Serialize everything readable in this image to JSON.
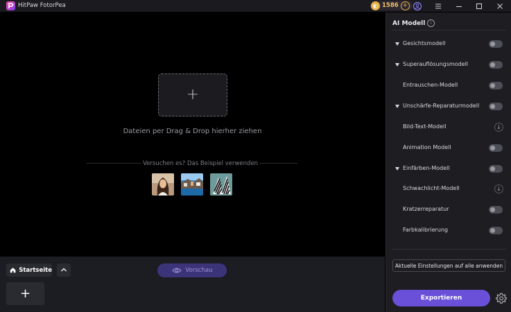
{
  "window": {
    "title": "HitPaw FotorPea",
    "coins": "1586"
  },
  "canvas": {
    "drop_text": "Dateien per Drag & Drop hierher ziehen",
    "try_text": "Versuchen es? Das Beispiel verwenden",
    "samples": [
      "portrait-sample",
      "coast-sample",
      "zebra-sample"
    ]
  },
  "bottom": {
    "home_label": "Startseite",
    "preview_label": "Vorschau"
  },
  "panel": {
    "title": "AI Modell",
    "models": [
      {
        "label": "Gesichtsmodell",
        "caret": true,
        "control": "toggle",
        "on": false
      },
      {
        "label": "Superauflösungsmodell",
        "caret": true,
        "control": "toggle",
        "on": false
      },
      {
        "label": "Entrauschen-Modell",
        "caret": false,
        "control": "toggle",
        "on": false
      },
      {
        "label": "Unschärfe-Reparaturmodell",
        "caret": true,
        "control": "toggle",
        "on": false
      },
      {
        "label": "Bild-Text-Modell",
        "caret": false,
        "control": "download",
        "on": false
      },
      {
        "label": "Animation Modell",
        "caret": false,
        "control": "toggle",
        "on": false
      },
      {
        "label": "Einfärben-Modell",
        "caret": true,
        "control": "toggle",
        "on": false
      },
      {
        "label": "Schwachlicht-Modell",
        "caret": false,
        "control": "download",
        "on": false
      },
      {
        "label": "Kratzerreparatur",
        "caret": false,
        "control": "toggle",
        "on": false
      },
      {
        "label": "Farbkalibrierung",
        "caret": false,
        "control": "toggle",
        "on": false
      }
    ],
    "apply_all_label": "Aktuelle Einstellungen auf alle anwenden",
    "export_label": "Exportieren"
  },
  "colors": {
    "accent": "#6a50d9",
    "preview_bg": "#3c3479",
    "coin": "#e9b24b"
  }
}
